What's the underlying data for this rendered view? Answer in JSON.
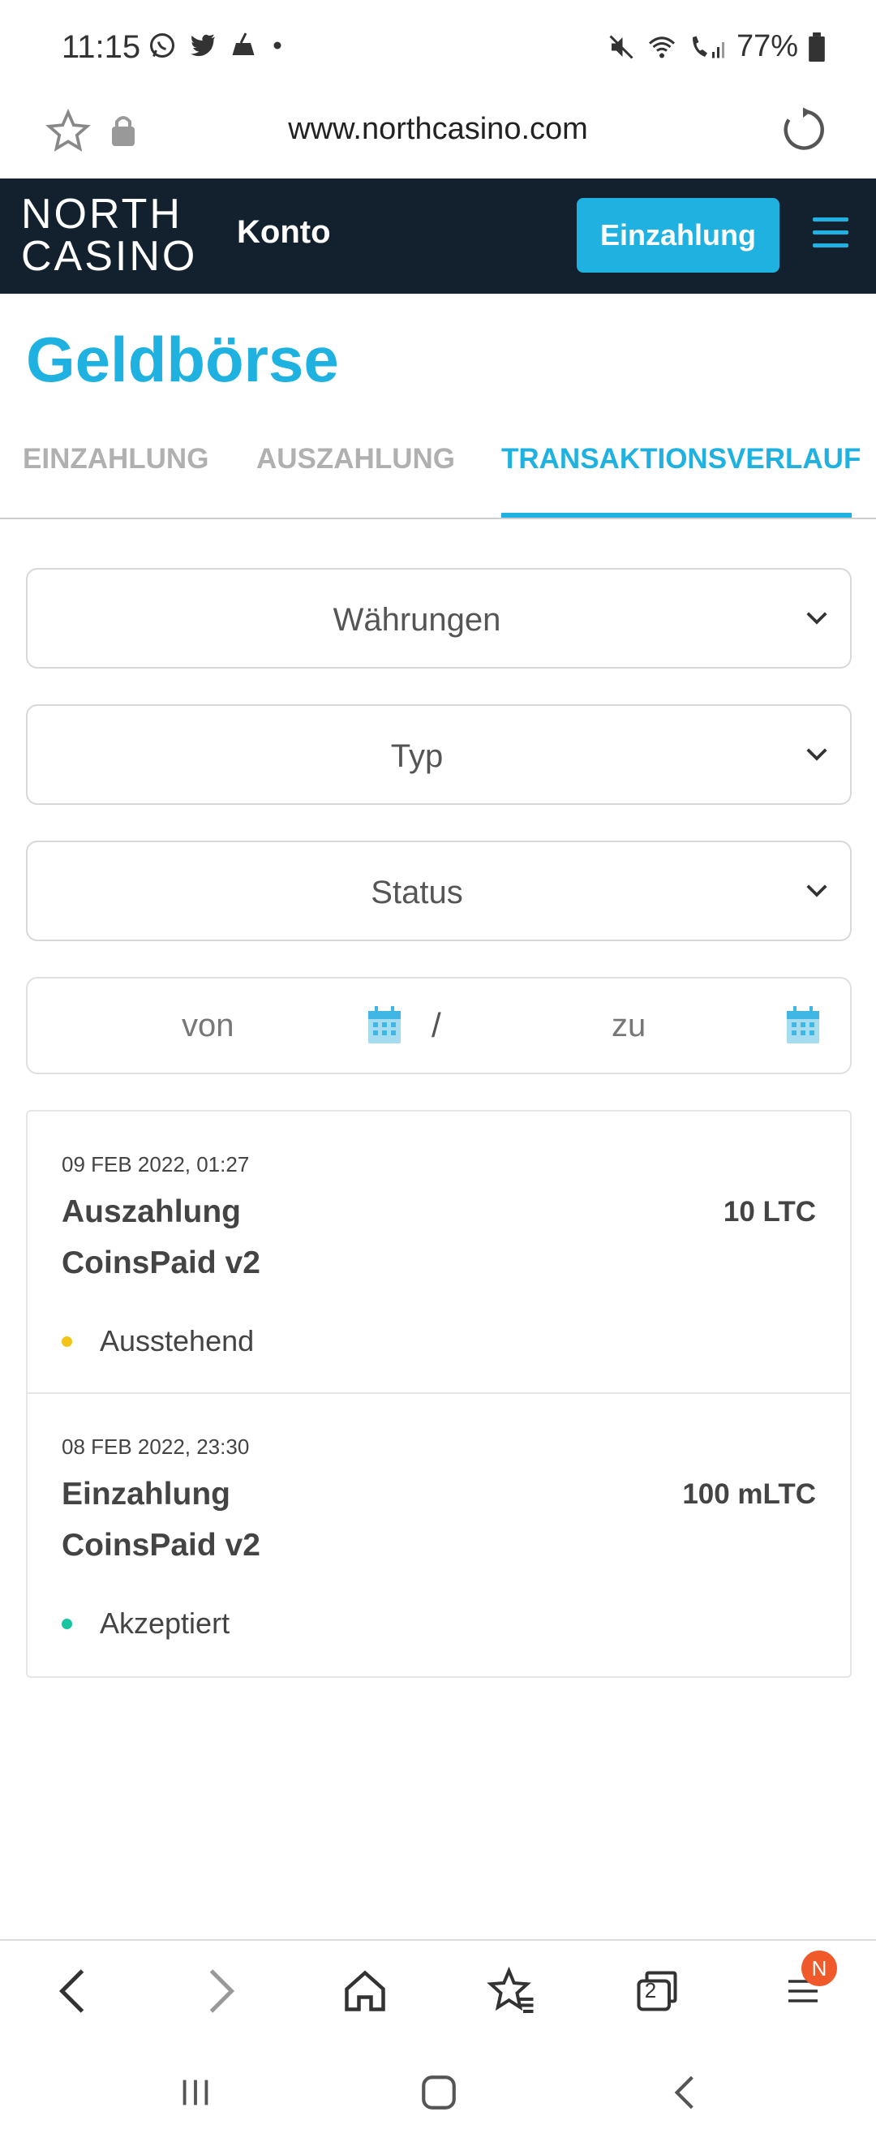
{
  "status_bar": {
    "time": "11:15",
    "battery": "77%"
  },
  "browser": {
    "url": "www.northcasino.com"
  },
  "site_header": {
    "logo_line1": "NORTH",
    "logo_line2": "CASINO",
    "account_label": "Konto",
    "deposit_button": "Einzahlung"
  },
  "page": {
    "title": "Geldbörse"
  },
  "tabs": [
    {
      "label": "EINZAHLUNG",
      "active": false
    },
    {
      "label": "AUSZAHLUNG",
      "active": false
    },
    {
      "label": "TRANSAKTIONSVERLAUF",
      "active": true
    }
  ],
  "filters": {
    "currencies": "Währungen",
    "type": "Typ",
    "status": "Status",
    "date_from": "von",
    "date_separator": "/",
    "date_to": "zu"
  },
  "transactions": [
    {
      "date": "09 FEB 2022, 01:27",
      "title_line1": "Auszahlung",
      "title_line2": "CoinsPaid v2",
      "amount": "10 LTC",
      "status": "Ausstehend",
      "status_color": "#f2c418"
    },
    {
      "date": "08 FEB 2022, 23:30",
      "title_line1": "Einzahlung",
      "title_line2": "CoinsPaid v2",
      "amount": "100 mLTC",
      "status": "Akzeptiert",
      "status_color": "#19c4a0"
    }
  ],
  "browser_toolbar": {
    "tabs_count": "2",
    "menu_badge": "N"
  },
  "colors": {
    "accent": "#1fb1e0",
    "header_bg": "#13212f"
  }
}
